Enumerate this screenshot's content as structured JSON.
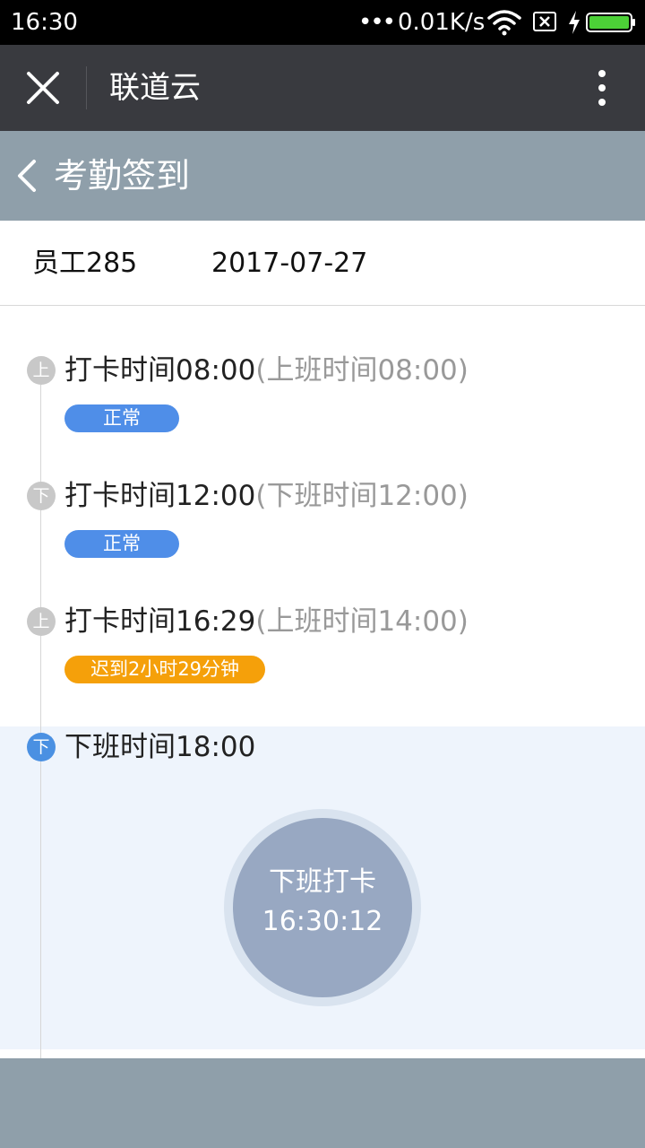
{
  "status_bar": {
    "time": "16:30",
    "dots": "•••",
    "net_speed": "0.01K/s",
    "battery_color": "#4cd137"
  },
  "title_bar": {
    "app_name": "联道云",
    "close_icon": "close-icon",
    "more_icon": "more-vertical-icon"
  },
  "header": {
    "title": "考勤签到",
    "back_icon": "chevron-left-icon"
  },
  "info": {
    "employee": "员工285",
    "date": "2017-07-27"
  },
  "timeline": [
    {
      "type_char": "上",
      "title": "打卡时间08:00",
      "sub": "(上班时间08:00)",
      "badge": "正常",
      "status": "normal"
    },
    {
      "type_char": "下",
      "title": "打卡时间12:00",
      "sub": "(下班时间12:00)",
      "badge": "正常",
      "status": "normal"
    },
    {
      "type_char": "上",
      "title": "打卡时间16:29",
      "sub": "(上班时间14:00)",
      "badge": "迟到2小时29分钟",
      "status": "late"
    },
    {
      "type_char": "下",
      "title": "下班时间18:00",
      "status": "active"
    }
  ],
  "punch": {
    "label": "下班打卡",
    "time": "16:30:12"
  },
  "colors": {
    "normal_badge": "#4f8ee8",
    "late_badge": "#f5a00a",
    "active_dot": "#4a90e2",
    "header_bg": "#8f9faa",
    "title_bar_bg": "#393a3f"
  }
}
